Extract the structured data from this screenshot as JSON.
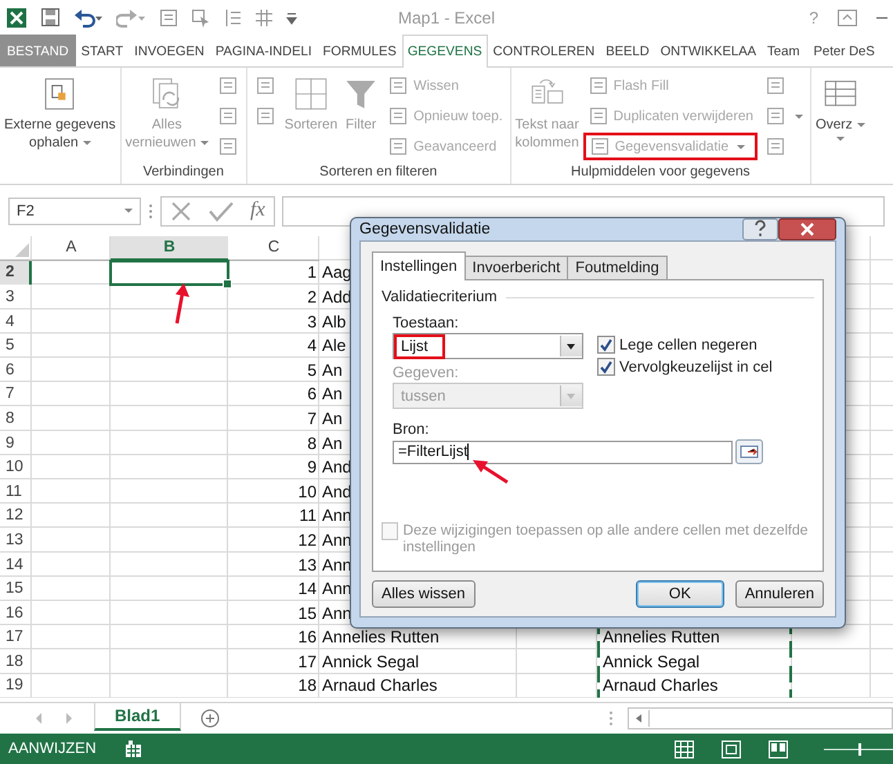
{
  "title_bar": {
    "title": "Map1 - Excel",
    "help": "?"
  },
  "ribbon_tabs": [
    {
      "label": "BESTAND",
      "kind": "file",
      "selected": false
    },
    {
      "label": "START",
      "kind": "tab",
      "selected": false
    },
    {
      "label": "INVOEGEN",
      "kind": "tab",
      "selected": false
    },
    {
      "label": "PAGINA-INDELI",
      "kind": "tab",
      "selected": false
    },
    {
      "label": "FORMULES",
      "kind": "tab",
      "selected": false
    },
    {
      "label": "GEGEVENS",
      "kind": "tab",
      "selected": true
    },
    {
      "label": "CONTROLEREN",
      "kind": "tab",
      "selected": false
    },
    {
      "label": "BEELD",
      "kind": "tab",
      "selected": false
    },
    {
      "label": "ONTWIKKELAA",
      "kind": "tab",
      "selected": false
    },
    {
      "label": "Team",
      "kind": "tab",
      "selected": false
    },
    {
      "label": "Peter DeS",
      "kind": "user",
      "selected": false
    }
  ],
  "ribbon_groups": [
    {
      "items": [
        {
          "kind": "large",
          "lines": [
            "Externe gegevens",
            "ophalen"
          ],
          "dropdown": true,
          "disabled": false
        }
      ]
    },
    {
      "label": "Verbindingen",
      "items": [
        {
          "kind": "large",
          "lines": [
            "Alles",
            "vernieuwen"
          ],
          "dropdown": true,
          "disabled": true
        },
        {
          "kind": "stack",
          "items": [
            {
              "disabled": true,
              "dropdown": false
            },
            {
              "disabled": true,
              "dropdown": false
            },
            {
              "disabled": true,
              "dropdown": false
            }
          ]
        }
      ]
    },
    {
      "label": "Sorteren en filteren",
      "items": [
        {
          "kind": "stack",
          "items": [
            {
              "disabled": true,
              "dropdown": false
            },
            {
              "disabled": true,
              "dropdown": false
            }
          ]
        },
        {
          "kind": "large",
          "lines": [
            "Sorteren"
          ],
          "dropdown": false,
          "disabled": true
        },
        {
          "kind": "large",
          "lines": [
            "Filter"
          ],
          "dropdown": false,
          "disabled": true
        },
        {
          "kind": "stack",
          "items": [
            {
              "label": "Wissen",
              "disabled": true,
              "dropdown": false
            },
            {
              "label": "Opnieuw toep.",
              "disabled": true,
              "dropdown": false
            },
            {
              "label": "Geavanceerd",
              "disabled": true,
              "dropdown": false
            }
          ]
        }
      ]
    },
    {
      "label": "Hulpmiddelen voor gegevens",
      "items": [
        {
          "kind": "large",
          "lines": [
            "Tekst naar",
            "kolommen"
          ],
          "dropdown": false,
          "disabled": true
        },
        {
          "kind": "stack",
          "items": [
            {
              "label": "Flash Fill",
              "disabled": true,
              "dropdown": false
            },
            {
              "label": "Duplicaten verwijderen",
              "disabled": true,
              "dropdown": false
            },
            {
              "label": "Gegevensvalidatie",
              "disabled": true,
              "dropdown": true,
              "highlighted": true
            }
          ]
        },
        {
          "kind": "stack",
          "items": [
            {
              "disabled": true,
              "dropdown": false
            },
            {
              "disabled": true,
              "dropdown": true
            },
            {
              "disabled": true,
              "dropdown": false
            }
          ]
        }
      ]
    },
    {
      "items": [
        {
          "kind": "large",
          "lines": [
            "Overz"
          ],
          "dropdown": true,
          "disabled": false
        }
      ]
    }
  ],
  "formula_bar": {
    "name_box": "F2",
    "function_label": "fx"
  },
  "sheet": {
    "columns": [
      {
        "label": "A",
        "selected": false
      },
      {
        "label": "B",
        "selected": true
      },
      {
        "label": "C",
        "selected": false
      }
    ],
    "rows": [
      {
        "number": "2",
        "selected": true,
        "column_c": "1",
        "column_d": "Aag"
      },
      {
        "number": "3",
        "selected": false,
        "column_c": "2",
        "column_d": "Add"
      },
      {
        "number": "4",
        "selected": false,
        "column_c": "3",
        "column_d": "Alb"
      },
      {
        "number": "5",
        "selected": false,
        "column_c": "4",
        "column_d": "Ale"
      },
      {
        "number": "6",
        "selected": false,
        "column_c": "5",
        "column_d": "An"
      },
      {
        "number": "7",
        "selected": false,
        "column_c": "6",
        "column_d": "An"
      },
      {
        "number": "8",
        "selected": false,
        "column_c": "7",
        "column_d": "An"
      },
      {
        "number": "9",
        "selected": false,
        "column_c": "8",
        "column_d": "An"
      },
      {
        "number": "10",
        "selected": false,
        "column_c": "9",
        "column_d": "And"
      },
      {
        "number": "11",
        "selected": false,
        "column_c": "10",
        "column_d": "And"
      },
      {
        "number": "12",
        "selected": false,
        "column_c": "11",
        "column_d": "Ann"
      },
      {
        "number": "13",
        "selected": false,
        "column_c": "12",
        "column_d": "Ann"
      },
      {
        "number": "14",
        "selected": false,
        "column_c": "13",
        "column_d": "Ann"
      },
      {
        "number": "15",
        "selected": false,
        "column_c": "14",
        "column_d": "Ann"
      },
      {
        "number": "16",
        "selected": false,
        "column_c": "15",
        "column_d": "Ann"
      },
      {
        "number": "17",
        "selected": false,
        "column_c": "16",
        "column_d": "Annelies Rutten",
        "column_f": "Annelies Rutten",
        "marquee": true
      },
      {
        "number": "18",
        "selected": false,
        "column_c": "17",
        "column_d": "Annick Segal",
        "column_f": "Annick Segal",
        "marquee": true
      },
      {
        "number": "19",
        "selected": false,
        "column_c": "18",
        "column_d": "Arnaud Charles",
        "column_f": "Arnaud Charles",
        "marquee": true
      }
    ]
  },
  "sheet_tabs": [
    {
      "label": "Blad1",
      "selected": true
    }
  ],
  "status_bar": {
    "mode": "AANWIJZEN",
    "zoom": {
      "level": 0.5
    }
  },
  "dialog": {
    "title": "Gegevensvalidatie",
    "tabs": [
      {
        "label": "Instellingen",
        "selected": true
      },
      {
        "label": "Invoerbericht",
        "selected": false
      },
      {
        "label": "Foutmelding",
        "selected": false
      }
    ],
    "group_label": "Validatiecriterium",
    "allow": {
      "label": "Toestaan:",
      "value": "Lijst",
      "highlighted": true
    },
    "options": [
      {
        "label": "Lege cellen negeren",
        "checked": true
      },
      {
        "label": "Vervolgkeuzelijst in cel",
        "checked": true
      }
    ],
    "data": {
      "label": "Gegeven:",
      "value": "tussen",
      "disabled": true
    },
    "source": {
      "label": "Bron:",
      "value": "=FilterLijst"
    },
    "apply_all": {
      "label": "Deze wijzigingen toepassen op alle andere cellen met dezelfde instellingen",
      "checked": false,
      "disabled": true
    },
    "buttons": [
      {
        "label": "Alles wissen",
        "kind": "secondary"
      },
      {
        "label": "OK",
        "kind": "default"
      },
      {
        "label": "Annuleren",
        "kind": "secondary"
      }
    ]
  }
}
